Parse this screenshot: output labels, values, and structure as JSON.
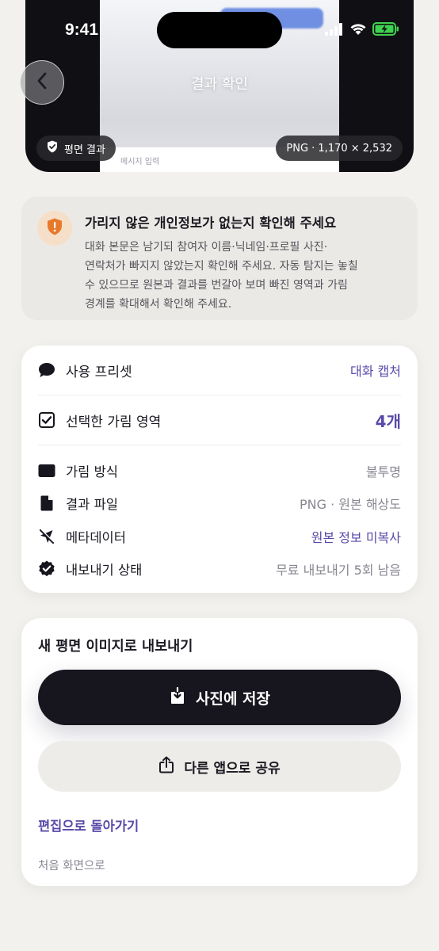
{
  "status": {
    "time": "9:41"
  },
  "preview": {
    "title": "결과 확인",
    "input_placeholder": "메시지 입력",
    "mode_chip": "평면 결과",
    "file_chip": "PNG · 1,170 × 2,532"
  },
  "notice": {
    "title": "가리지 않은 개인정보가 없는지 확인해 주세요",
    "lines": [
      "대화 본문은 남기되 참여자 이름·닉네임·프로필 사진·",
      "연락처가 빠지지 않았는지 확인해 주세요. 자동 탐지는 놓칠",
      "수 있으므로 원본과 결과를 번갈아 보며 빠진 영역과 가림",
      "경계를 확대해서 확인해 주세요."
    ]
  },
  "summary": {
    "preset": {
      "label": "사용 프리셋",
      "value": "대화 캡처"
    },
    "regions": {
      "label": "선택한 가림 영역",
      "value": "4개"
    },
    "method": {
      "label": "가림 방식",
      "value": "불투명"
    },
    "file": {
      "label": "결과 파일",
      "value": "PNG · 원본 해상도"
    },
    "metadata": {
      "label": "메타데이터",
      "value": "원본 정보 미복사"
    },
    "export_status": {
      "label": "내보내기 상태",
      "value": "무료 내보내기 5회 남음"
    }
  },
  "export": {
    "title": "새 평면 이미지로 내보내기",
    "save_label": "사진에 저장",
    "share_label": "다른 앱으로 공유",
    "back_to_edit": "편집으로 돌아가기",
    "home": "처음 화면으로"
  },
  "colors": {
    "accent": "#5a4aa8",
    "primary_button": "#17161f",
    "warning": "#e8782a"
  }
}
